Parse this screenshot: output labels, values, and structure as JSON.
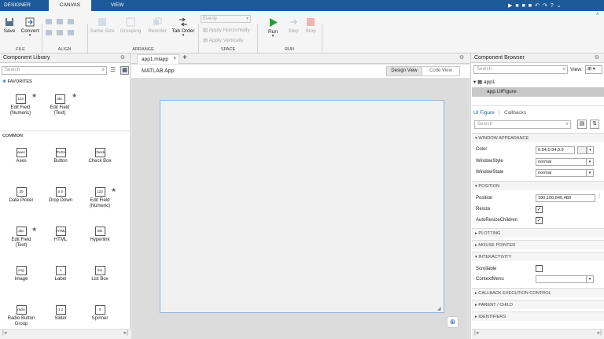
{
  "tabs": [
    "DESIGNER",
    "CANVAS",
    "VIEW"
  ],
  "ribbon": {
    "file": {
      "label": "FILE",
      "save": "Save",
      "convert": "Convert"
    },
    "align": {
      "label": "ALIGN"
    },
    "arrange": {
      "label": "ARRANGE",
      "same_size": "Same Size",
      "grouping": "Grouping",
      "reorder": "Reorder",
      "tab_order": "Tab Order"
    },
    "space": {
      "label": "SPACE",
      "evenly": "Evenly",
      "apply_h": "Apply Horizontally",
      "apply_v": "Apply Vertically"
    },
    "run": {
      "label": "RUN",
      "run": "Run",
      "step": "Step",
      "stop": "Stop"
    }
  },
  "library": {
    "title": "Component Library",
    "search_placeholder": "Search",
    "favorites_label": "FAVORITES",
    "common_label": "COMMON",
    "favorites": [
      {
        "icon": "123",
        "label": "Edit Field (Numeric)"
      },
      {
        "icon": "abc",
        "label": "Edit Field (Text)"
      }
    ],
    "common": [
      {
        "icon": "axes",
        "label": "Axes"
      },
      {
        "icon": "PUSH",
        "label": "Button"
      },
      {
        "icon": "check",
        "label": "Check Box"
      },
      {
        "icon": "30",
        "label": "Date Picker"
      },
      {
        "icon": "a b",
        "label": "Drop Down"
      },
      {
        "icon": "123",
        "label": "Edit Field (Numeric)"
      },
      {
        "icon": "abc",
        "label": "Edit Field (Text)"
      },
      {
        "icon": "HTML",
        "label": "HTML"
      },
      {
        "icon": "link",
        "label": "Hyperlink"
      },
      {
        "icon": "img",
        "label": "Image"
      },
      {
        "icon": "A",
        "label": "Label"
      },
      {
        "icon": "list",
        "label": "List Box"
      },
      {
        "icon": "radio",
        "label": "Radio Button Group"
      },
      {
        "icon": "1 2",
        "label": "Slider"
      },
      {
        "icon": "0",
        "label": "Spinner"
      }
    ]
  },
  "document": {
    "tab": "app1.mlapp",
    "app_title": "MATLAB App",
    "design_view": "Design View",
    "code_view": "Code View"
  },
  "browser": {
    "title": "Component Browser",
    "search_placeholder": "Search",
    "view_label": "View:",
    "tree_root": "app1",
    "tree_child": "app.UIFigure",
    "tab_uifigure": "UI Figure",
    "tab_sep": "|",
    "tab_callbacks": "Callbacks",
    "search2_placeholder": "Search",
    "sections": {
      "window_appearance": "WINDOW APPEARANCE",
      "position": "POSITION",
      "plotting": "PLOTTING",
      "mouse_pointer": "MOUSE POINTER",
      "interactivity": "INTERACTIVITY",
      "callback": "CALLBACK EXECUTION CONTROL",
      "parent_child": "PARENT / CHILD",
      "identifiers": "IDENTIFIERS"
    },
    "props": {
      "color_label": "Color",
      "color_value": "0.94,0.94,0.9",
      "windowstyle_label": "WindowStyle",
      "windowstyle_value": "normal",
      "windowstate_label": "WindowState",
      "windowstate_value": "normal",
      "position_label": "Position",
      "position_value": "100,100,640,480",
      "resize_label": "Resize",
      "autoresize_label": "AutoResizeChildren",
      "scrollable_label": "Scrollable",
      "contextmenu_label": "ContextMenu"
    }
  },
  "colors": {
    "accent": "#1c5a99",
    "run_green": "#2e9d3a",
    "stop_red": "#e08080"
  }
}
